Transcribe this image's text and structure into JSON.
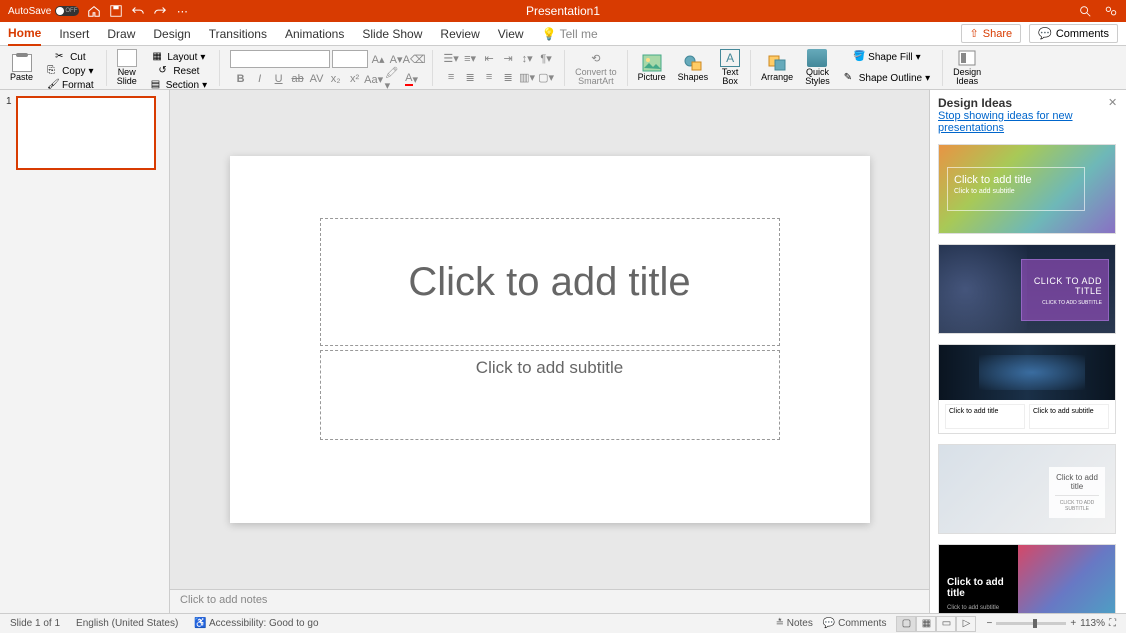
{
  "titlebar": {
    "autosave_label": "AutoSave",
    "autosave_state": "OFF",
    "doc_title": "Presentation1"
  },
  "tabs": {
    "home": "Home",
    "insert": "Insert",
    "draw": "Draw",
    "design": "Design",
    "transitions": "Transitions",
    "animations": "Animations",
    "slideshow": "Slide Show",
    "review": "Review",
    "view": "View",
    "tellme": "Tell me",
    "share": "Share",
    "comments": "Comments"
  },
  "ribbon": {
    "paste": "Paste",
    "cut": "Cut",
    "copy": "Copy",
    "format": "Format",
    "newslide": "New\nSlide",
    "layout": "Layout",
    "reset": "Reset",
    "section": "Section",
    "convert": "Convert to\nSmartArt",
    "picture": "Picture",
    "shapes": "Shapes",
    "textbox": "Text\nBox",
    "arrange": "Arrange",
    "quickstyles": "Quick\nStyles",
    "shapefill": "Shape Fill",
    "shapeoutline": "Shape Outline",
    "designideas": "Design\nIdeas"
  },
  "slide": {
    "title_placeholder": "Click to add title",
    "subtitle_placeholder": "Click to add subtitle",
    "notes_placeholder": "Click to add notes",
    "thumb_number": "1"
  },
  "design_panel": {
    "title": "Design Ideas",
    "stop_link": "Stop showing ideas for new presentations",
    "ideas": [
      {
        "title": "Click to add title",
        "sub": "Click to add subtitle"
      },
      {
        "title": "CLICK TO ADD TITLE",
        "sub": "CLICK TO ADD SUBTITLE"
      },
      {
        "title": "Click to add title",
        "sub": "Click to add subtitle"
      },
      {
        "title": "Click to add title",
        "sub": "CLICK TO ADD SUBTITLE"
      },
      {
        "title": "Click to add title",
        "sub": "Click to add subtitle"
      }
    ]
  },
  "statusbar": {
    "slide_info": "Slide 1 of 1",
    "language": "English (United States)",
    "accessibility": "Accessibility: Good to go",
    "notes": "Notes",
    "comments": "Comments",
    "zoom": "113%"
  }
}
